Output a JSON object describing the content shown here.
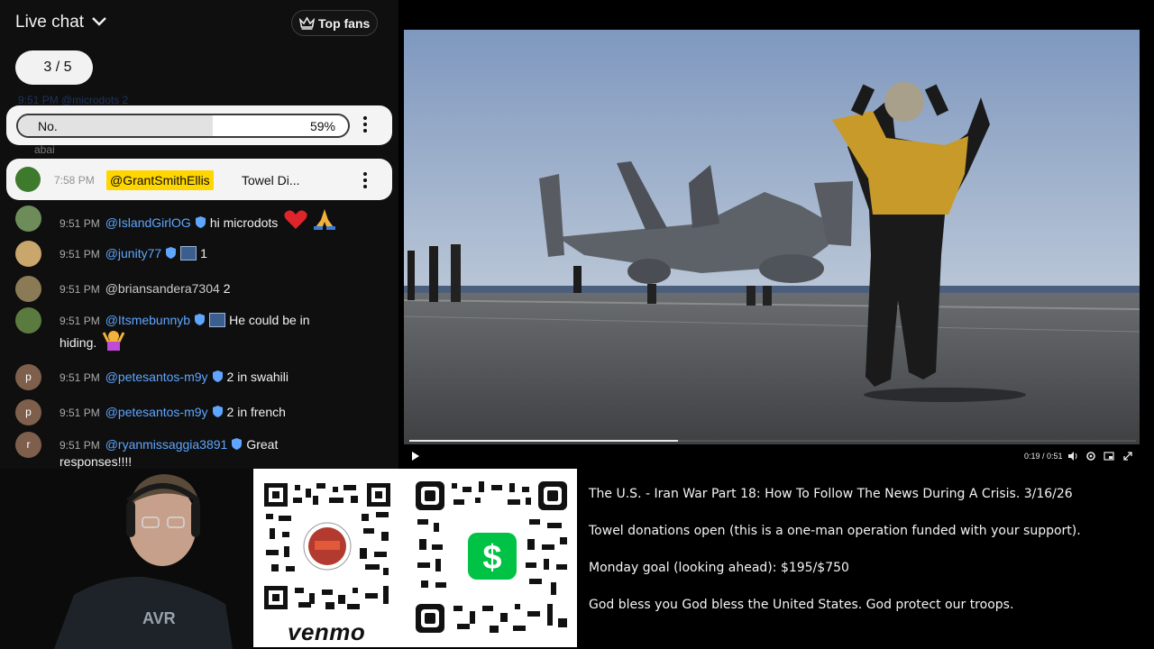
{
  "chat": {
    "title": "Live chat",
    "top_fans_label": "Top fans",
    "pager": "3 / 5",
    "ghost_text": "9:51 PM  @microdots  2",
    "poll": {
      "option": "No.",
      "percent_label": "59%",
      "percent": 59
    },
    "poll_subtext": "abai",
    "pinned": {
      "time": "7:58 PM",
      "author": "@GrantSmithEllis",
      "message": "Towel Di..."
    },
    "messages": [
      {
        "time": "9:51 PM",
        "author": "@IslandGirlOG",
        "text": "hi microdots",
        "avatar_color": "#6d8c5a"
      },
      {
        "time": "9:51 PM",
        "author": "@junity77",
        "text": "1",
        "avatar_color": "#c9a66b"
      },
      {
        "time": "9:51 PM",
        "author": "@briansandera7304",
        "text": "2",
        "avatar_color": "#8a7a55"
      },
      {
        "time": "9:51 PM",
        "author": "@Itsmebunnyb",
        "text": "He could be in",
        "wrap": "hiding.",
        "avatar_color": "#5b7a3f"
      },
      {
        "time": "9:51 PM",
        "author": "@petesantos-m9y",
        "text": "2 in swahili",
        "avatar": "p",
        "avatar_color": "#7d5f4c"
      },
      {
        "time": "9:51 PM",
        "author": "@petesantos-m9y",
        "text": "2 in french",
        "avatar": "p",
        "avatar_color": "#7d5f4c"
      },
      {
        "time": "9:51 PM",
        "author": "@ryanmissaggia3891",
        "text": "Great",
        "wrap": "responses!!!!",
        "avatar": "r",
        "avatar_color": "#7d5f4c"
      }
    ]
  },
  "player": {
    "time": "0:19 / 0:51",
    "progress": 0.37
  },
  "payments": {
    "venmo_label": "venmo"
  },
  "info": {
    "line1": "The U.S. - Iran War Part 18: How To Follow The News During A Crisis. 3/16/26",
    "line2": "Towel donations open (this is a one-man operation funded with your support).",
    "line3": "Monday goal (looking ahead): $195/$750",
    "line4": "God bless you God bless the United States. God protect our troops."
  },
  "colors": {
    "author_link": "#5ea6ff",
    "highlight": "#ffd600",
    "panel_bg": "#0f0f0f"
  }
}
